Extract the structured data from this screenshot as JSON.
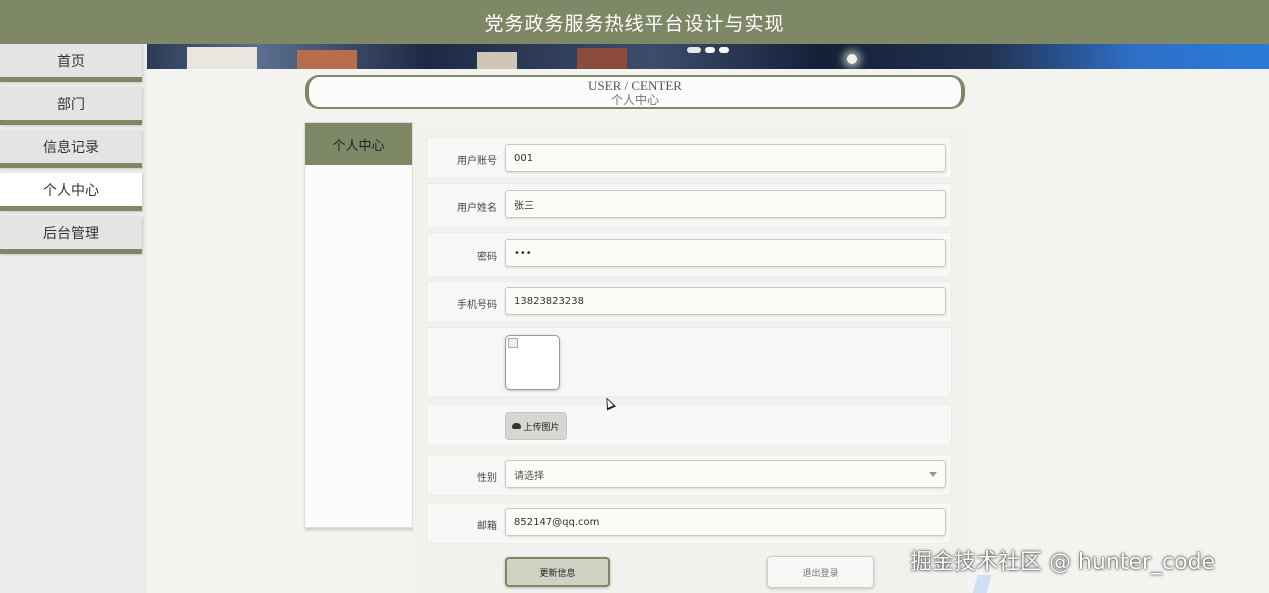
{
  "header": {
    "title": "党务政务服务热线平台设计与实现"
  },
  "sidebar": {
    "items": [
      {
        "label": "首页",
        "active": false
      },
      {
        "label": "部门",
        "active": false
      },
      {
        "label": "信息记录",
        "active": false
      },
      {
        "label": "个人中心",
        "active": true
      },
      {
        "label": "后台管理",
        "active": false
      }
    ]
  },
  "center_title": {
    "en": "USER / CENTER",
    "zh": "个人中心"
  },
  "tab_panel": {
    "active_tab": "个人中心"
  },
  "form": {
    "account": {
      "label": "用户账号",
      "value": "001"
    },
    "name": {
      "label": "用户姓名",
      "value": "张三"
    },
    "password": {
      "label": "密码",
      "value": "•••"
    },
    "phone": {
      "label": "手机号码",
      "value": "13823823238"
    },
    "avatar": {
      "alt": ""
    },
    "upload": {
      "label": "上传图片",
      "icon": "cloud-upload-icon"
    },
    "gender": {
      "label": "性别",
      "placeholder": "请选择"
    },
    "email": {
      "label": "邮箱",
      "value": "852147@qq.com"
    }
  },
  "buttons": {
    "update": "更新信息",
    "logout": "退出登录"
  },
  "watermark": "掘金技术社区 @ hunter_code",
  "colors": {
    "accent": "#7f8866",
    "header_bg": "#7f8866"
  }
}
